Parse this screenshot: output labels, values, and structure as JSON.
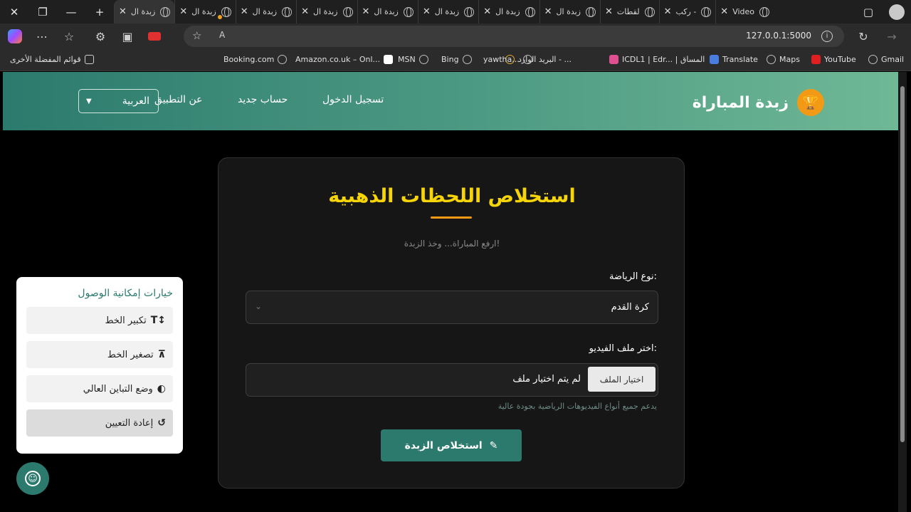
{
  "browser": {
    "tabs": [
      {
        "label": "Video"
      },
      {
        "label": "ركب -"
      },
      {
        "label": "لقطات"
      },
      {
        "label": "زبدة ال"
      },
      {
        "label": "زبدة ال"
      },
      {
        "label": "زبدة ال"
      },
      {
        "label": "زبدة ال"
      },
      {
        "label": "زبدة ال"
      },
      {
        "label": "زبدة ال"
      },
      {
        "label": "زبدة ال"
      },
      {
        "label": "زبدة ال"
      }
    ],
    "url": "127.0.0.1:5000",
    "read_aloud": "A",
    "bookmarks": [
      {
        "label": "Gmail"
      },
      {
        "label": "YouTube"
      },
      {
        "label": "Maps"
      },
      {
        "label": "Translate"
      },
      {
        "label": "ICDL1 | Edr... | المساق"
      },
      {
        "label": "البريد الوارد - ..."
      },
      {
        "label": "yawtha..."
      },
      {
        "label": "Bing"
      },
      {
        "label": "MSN"
      },
      {
        "label": "Amazon.co.uk – Onl..."
      },
      {
        "label": "Booking.com"
      },
      {
        "label": "قوائم المفضلة الأخرى"
      }
    ]
  },
  "header": {
    "brand": "زبدة المباراة",
    "nav": {
      "login": "تسجيل الدخول",
      "signup": "حساب جديد",
      "about": "عن التطبيق"
    },
    "language": "العربية"
  },
  "card": {
    "title": "استخلاص اللحظات الذهبية",
    "subtitle": "ارفع المباراة... وخذ الزبدة!",
    "sport_label": "نوع الرياضة:",
    "sport_value": "كرة القدم",
    "file_label": "اختر ملف الفيديو:",
    "file_button": "اختيار الملف",
    "file_status": "لم يتم اختيار ملف",
    "hint": "يدعم جميع أنواع الفيديوهات الرياضية بجودة عالية",
    "submit": "استخلاص الزبدة"
  },
  "accessibility": {
    "title": "خيارات إمكانية الوصول",
    "increase": "تكبير الخط",
    "decrease": "تصغير الخط",
    "contrast": "وضع التباين العالي",
    "reset": "إعادة التعيين"
  },
  "colors": {
    "accent": "#2c7a6d",
    "title": "#f5d40a",
    "trophy": "#f29a16"
  }
}
